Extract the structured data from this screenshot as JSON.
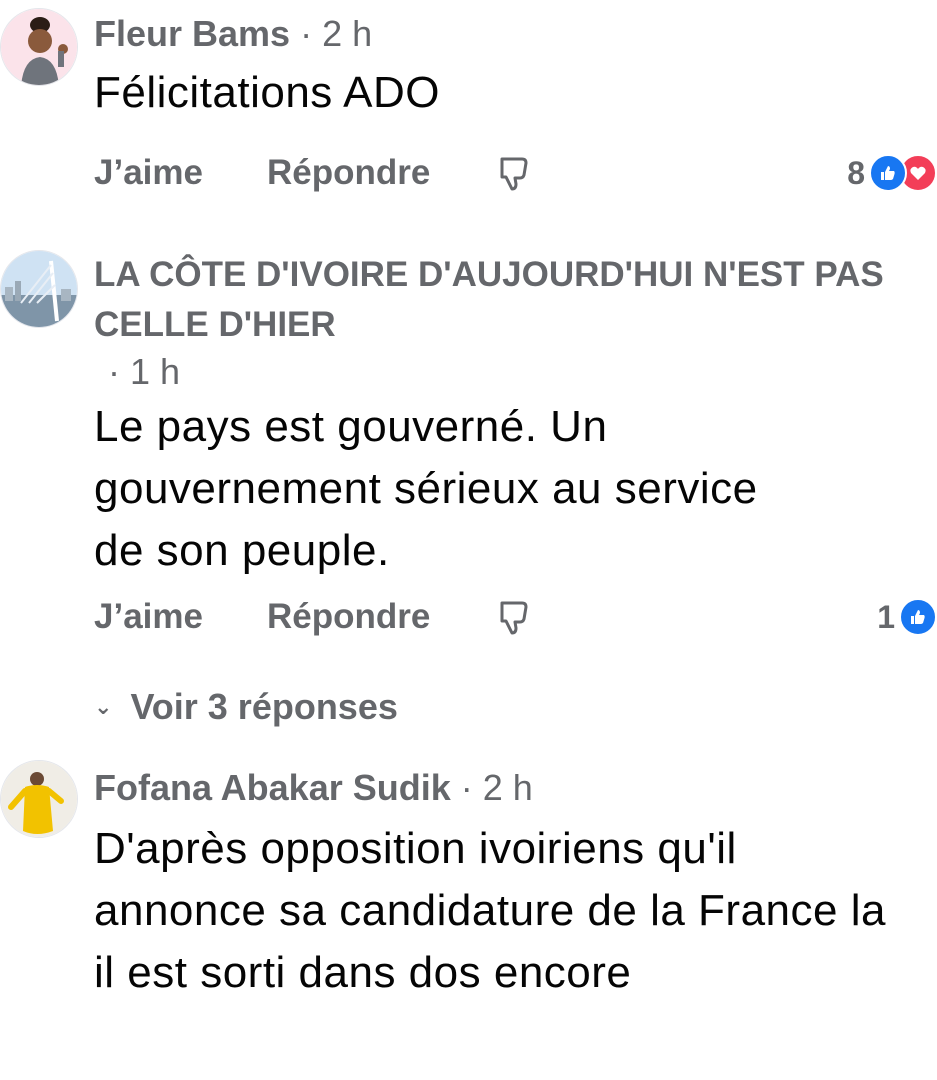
{
  "comments": [
    {
      "author": "Fleur Bams",
      "time": "2 h",
      "text": "Félicitations ADO",
      "like_label": "J’aime",
      "reply_label": "Répondre",
      "reaction_count": "8"
    },
    {
      "author": "LA CÔTE D'IVOIRE D'AUJOURD'HUI N'EST PAS CELLE D'HIER",
      "time": "1 h",
      "text": "Le pays est gouverné. Un gouvernement sérieux au service de son peuple.",
      "like_label": "J’aime",
      "reply_label": "Répondre",
      "reaction_count": "1",
      "view_replies": "Voir 3 réponses"
    },
    {
      "author": "Fofana Abakar Sudik",
      "time": "2 h",
      "text": "D'après opposition ivoiriens qu'il annonce sa candidature de la France la il est sorti dans dos encore"
    }
  ],
  "separator": "·",
  "icons": {
    "dislike": "thumbs-down-outline-icon",
    "like": "like-reaction-icon",
    "love": "love-reaction-icon",
    "chevron": "chevron-down-icon"
  },
  "colors": {
    "like": "#1877f2",
    "love": "#f33e58",
    "meta": "#65676b",
    "text": "#050505"
  }
}
